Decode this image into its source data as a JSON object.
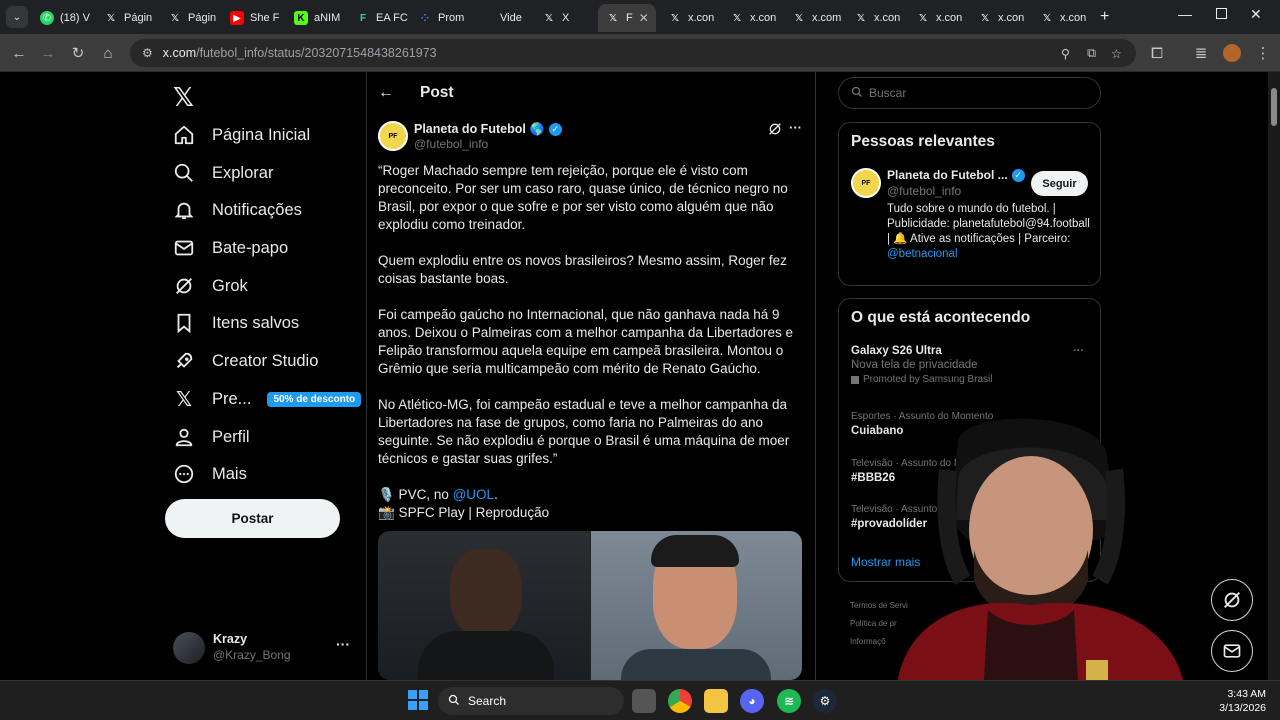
{
  "browser": {
    "tabs": [
      {
        "label": "(18) V",
        "fav": "whatsapp-icon"
      },
      {
        "label": "Págin",
        "fav": "x-icon"
      },
      {
        "label": "Págin",
        "fav": "x-icon"
      },
      {
        "label": "She F",
        "fav": "youtube-icon"
      },
      {
        "label": "aNIM",
        "fav": "k-icon"
      },
      {
        "label": "EA FC",
        "fav": "fc-icon"
      },
      {
        "label": "Prom",
        "fav": "dots-icon"
      },
      {
        "label": "Vide",
        "fav": "video-icon"
      },
      {
        "label": "X",
        "fav": "x-icon"
      },
      {
        "label": "F",
        "fav": "x-icon",
        "active": true
      },
      {
        "label": "x.con",
        "fav": "x-icon"
      },
      {
        "label": "x.con",
        "fav": "x-icon"
      },
      {
        "label": "x.com",
        "fav": "x-icon"
      },
      {
        "label": "x.con",
        "fav": "x-icon"
      },
      {
        "label": "x.con",
        "fav": "x-icon"
      },
      {
        "label": "x.con",
        "fav": "x-icon"
      },
      {
        "label": "x.con",
        "fav": "x-icon"
      }
    ],
    "url_domain": "x.com",
    "url_path": "/futebol_info/status/2032071548438261973"
  },
  "sidebar": {
    "items": [
      {
        "label": "Página Inicial",
        "icon": "home-icon"
      },
      {
        "label": "Explorar",
        "icon": "search-icon"
      },
      {
        "label": "Notificações",
        "icon": "bell-icon"
      },
      {
        "label": "Bate-papo",
        "icon": "mail-icon"
      },
      {
        "label": "Grok",
        "icon": "grok-icon"
      },
      {
        "label": "Itens salvos",
        "icon": "bookmark-icon"
      },
      {
        "label": "Creator Studio",
        "icon": "rocket-icon"
      },
      {
        "label": "Pre...",
        "icon": "x-icon"
      },
      {
        "label": "Perfil",
        "icon": "person-icon"
      },
      {
        "label": "Mais",
        "icon": "more-circle-icon"
      }
    ],
    "premium_badge": "50% de desconto",
    "post_button": "Postar",
    "user": {
      "name": "Krazy",
      "handle": "@Krazy_Bong"
    }
  },
  "post": {
    "header_title": "Post",
    "author_name": "Planeta do Futebol",
    "author_handle": "@futebol_info",
    "paragraphs": [
      "“Roger Machado sempre tem rejeição, porque ele é visto com preconceito. Por ser um caso raro, quase único, de técnico negro no Brasil, por expor o que sofre e por ser visto como alguém que não explodiu como treinador.",
      "Quem explodiu entre os novos brasileiros? Mesmo assim, Roger fez coisas bastante boas.",
      "Foi campeão gaúcho no Internacional, que não ganhava nada há 9 anos. Deixou o Palmeiras com a melhor campanha da Libertadores e Felipão transformou aquela equipe em campeã brasileira. Montou o Grêmio que seria multicampeão com mérito de Renato Gaúcho.",
      "No Atlético-MG, foi campeão estadual e teve a melhor campanha da Libertadores na fase de grupos, como faria no Palmeiras do ano seguinte. Se não explodiu é porque o Brasil é uma máquina de moer técnicos e gastar suas grifes.”"
    ],
    "credit_line1_prefix": "🎙️ PVC, no ",
    "credit_line1_link": "@UOL",
    "credit_line1_suffix": ".",
    "credit_line2": "📸 SPFC Play | Reprodução"
  },
  "right": {
    "search_placeholder": "Buscar",
    "relevant_title": "Pessoas relevantes",
    "relevant_name": "Planeta do Futebol ...",
    "relevant_handle": "@futebol_info",
    "follow_label": "Seguir",
    "relevant_bio": "Tudo sobre o mundo do futebol. | Publicidade: planetafutebol@94.football | 🔔 Ative as notificações | Parceiro:",
    "relevant_bio_link": "@betnacional",
    "trends_title": "O que está acontecendo",
    "trends": [
      {
        "title": "Galaxy S26 Ultra",
        "sub": "Nova tela de privacidade",
        "promo": "Promoted by Samsung Brasil"
      },
      {
        "context": "Esportes · Assunto do Momento",
        "title": "Cuiabano"
      },
      {
        "context": "Televisão · Assunto do M",
        "title": "#BBB26"
      },
      {
        "context": "Televisão · Assunto do M",
        "title": "#provadolíder"
      }
    ],
    "show_more": "Mostrar mais",
    "footer_links": [
      "Termos de Servi",
      "Política de pr",
      "Informaçõ"
    ]
  },
  "taskbar": {
    "search_label": "Search",
    "time": "3:43 AM",
    "date": "3/13/2026"
  },
  "colors": {
    "accent": "#1d9bf0",
    "bg": "#000000",
    "border": "#2f3336"
  }
}
